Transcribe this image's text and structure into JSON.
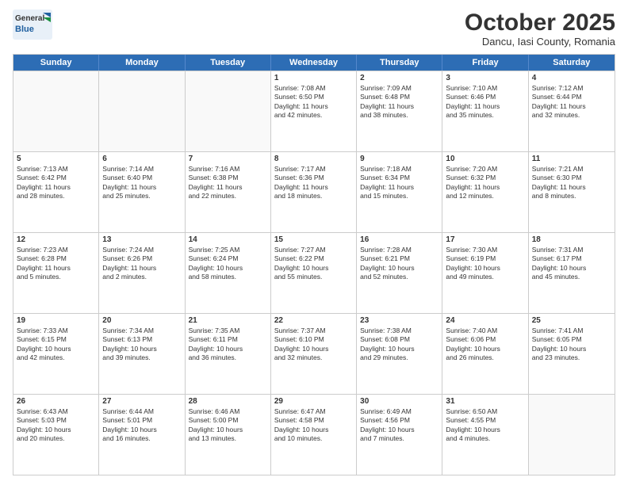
{
  "header": {
    "logo_general": "General",
    "logo_blue": "Blue",
    "month_title": "October 2025",
    "subtitle": "Dancu, Iasi County, Romania"
  },
  "weekdays": [
    "Sunday",
    "Monday",
    "Tuesday",
    "Wednesday",
    "Thursday",
    "Friday",
    "Saturday"
  ],
  "rows": [
    [
      {
        "day": "",
        "lines": []
      },
      {
        "day": "",
        "lines": []
      },
      {
        "day": "",
        "lines": []
      },
      {
        "day": "1",
        "lines": [
          "Sunrise: 7:08 AM",
          "Sunset: 6:50 PM",
          "Daylight: 11 hours",
          "and 42 minutes."
        ]
      },
      {
        "day": "2",
        "lines": [
          "Sunrise: 7:09 AM",
          "Sunset: 6:48 PM",
          "Daylight: 11 hours",
          "and 38 minutes."
        ]
      },
      {
        "day": "3",
        "lines": [
          "Sunrise: 7:10 AM",
          "Sunset: 6:46 PM",
          "Daylight: 11 hours",
          "and 35 minutes."
        ]
      },
      {
        "day": "4",
        "lines": [
          "Sunrise: 7:12 AM",
          "Sunset: 6:44 PM",
          "Daylight: 11 hours",
          "and 32 minutes."
        ]
      }
    ],
    [
      {
        "day": "5",
        "lines": [
          "Sunrise: 7:13 AM",
          "Sunset: 6:42 PM",
          "Daylight: 11 hours",
          "and 28 minutes."
        ]
      },
      {
        "day": "6",
        "lines": [
          "Sunrise: 7:14 AM",
          "Sunset: 6:40 PM",
          "Daylight: 11 hours",
          "and 25 minutes."
        ]
      },
      {
        "day": "7",
        "lines": [
          "Sunrise: 7:16 AM",
          "Sunset: 6:38 PM",
          "Daylight: 11 hours",
          "and 22 minutes."
        ]
      },
      {
        "day": "8",
        "lines": [
          "Sunrise: 7:17 AM",
          "Sunset: 6:36 PM",
          "Daylight: 11 hours",
          "and 18 minutes."
        ]
      },
      {
        "day": "9",
        "lines": [
          "Sunrise: 7:18 AM",
          "Sunset: 6:34 PM",
          "Daylight: 11 hours",
          "and 15 minutes."
        ]
      },
      {
        "day": "10",
        "lines": [
          "Sunrise: 7:20 AM",
          "Sunset: 6:32 PM",
          "Daylight: 11 hours",
          "and 12 minutes."
        ]
      },
      {
        "day": "11",
        "lines": [
          "Sunrise: 7:21 AM",
          "Sunset: 6:30 PM",
          "Daylight: 11 hours",
          "and 8 minutes."
        ]
      }
    ],
    [
      {
        "day": "12",
        "lines": [
          "Sunrise: 7:23 AM",
          "Sunset: 6:28 PM",
          "Daylight: 11 hours",
          "and 5 minutes."
        ]
      },
      {
        "day": "13",
        "lines": [
          "Sunrise: 7:24 AM",
          "Sunset: 6:26 PM",
          "Daylight: 11 hours",
          "and 2 minutes."
        ]
      },
      {
        "day": "14",
        "lines": [
          "Sunrise: 7:25 AM",
          "Sunset: 6:24 PM",
          "Daylight: 10 hours",
          "and 58 minutes."
        ]
      },
      {
        "day": "15",
        "lines": [
          "Sunrise: 7:27 AM",
          "Sunset: 6:22 PM",
          "Daylight: 10 hours",
          "and 55 minutes."
        ]
      },
      {
        "day": "16",
        "lines": [
          "Sunrise: 7:28 AM",
          "Sunset: 6:21 PM",
          "Daylight: 10 hours",
          "and 52 minutes."
        ]
      },
      {
        "day": "17",
        "lines": [
          "Sunrise: 7:30 AM",
          "Sunset: 6:19 PM",
          "Daylight: 10 hours",
          "and 49 minutes."
        ]
      },
      {
        "day": "18",
        "lines": [
          "Sunrise: 7:31 AM",
          "Sunset: 6:17 PM",
          "Daylight: 10 hours",
          "and 45 minutes."
        ]
      }
    ],
    [
      {
        "day": "19",
        "lines": [
          "Sunrise: 7:33 AM",
          "Sunset: 6:15 PM",
          "Daylight: 10 hours",
          "and 42 minutes."
        ]
      },
      {
        "day": "20",
        "lines": [
          "Sunrise: 7:34 AM",
          "Sunset: 6:13 PM",
          "Daylight: 10 hours",
          "and 39 minutes."
        ]
      },
      {
        "day": "21",
        "lines": [
          "Sunrise: 7:35 AM",
          "Sunset: 6:11 PM",
          "Daylight: 10 hours",
          "and 36 minutes."
        ]
      },
      {
        "day": "22",
        "lines": [
          "Sunrise: 7:37 AM",
          "Sunset: 6:10 PM",
          "Daylight: 10 hours",
          "and 32 minutes."
        ]
      },
      {
        "day": "23",
        "lines": [
          "Sunrise: 7:38 AM",
          "Sunset: 6:08 PM",
          "Daylight: 10 hours",
          "and 29 minutes."
        ]
      },
      {
        "day": "24",
        "lines": [
          "Sunrise: 7:40 AM",
          "Sunset: 6:06 PM",
          "Daylight: 10 hours",
          "and 26 minutes."
        ]
      },
      {
        "day": "25",
        "lines": [
          "Sunrise: 7:41 AM",
          "Sunset: 6:05 PM",
          "Daylight: 10 hours",
          "and 23 minutes."
        ]
      }
    ],
    [
      {
        "day": "26",
        "lines": [
          "Sunrise: 6:43 AM",
          "Sunset: 5:03 PM",
          "Daylight: 10 hours",
          "and 20 minutes."
        ]
      },
      {
        "day": "27",
        "lines": [
          "Sunrise: 6:44 AM",
          "Sunset: 5:01 PM",
          "Daylight: 10 hours",
          "and 16 minutes."
        ]
      },
      {
        "day": "28",
        "lines": [
          "Sunrise: 6:46 AM",
          "Sunset: 5:00 PM",
          "Daylight: 10 hours",
          "and 13 minutes."
        ]
      },
      {
        "day": "29",
        "lines": [
          "Sunrise: 6:47 AM",
          "Sunset: 4:58 PM",
          "Daylight: 10 hours",
          "and 10 minutes."
        ]
      },
      {
        "day": "30",
        "lines": [
          "Sunrise: 6:49 AM",
          "Sunset: 4:56 PM",
          "Daylight: 10 hours",
          "and 7 minutes."
        ]
      },
      {
        "day": "31",
        "lines": [
          "Sunrise: 6:50 AM",
          "Sunset: 4:55 PM",
          "Daylight: 10 hours",
          "and 4 minutes."
        ]
      },
      {
        "day": "",
        "lines": []
      }
    ]
  ]
}
